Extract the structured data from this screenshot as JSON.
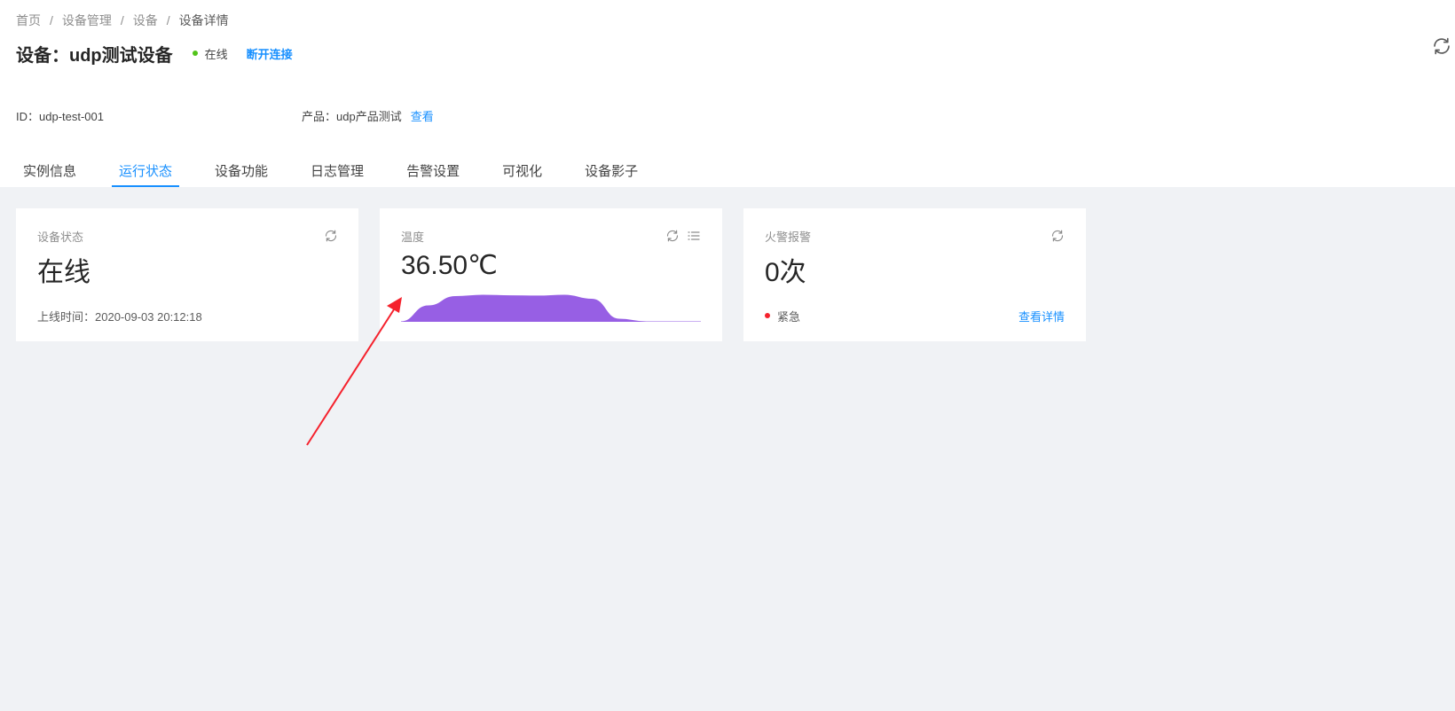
{
  "breadcrumb": [
    "首页",
    "设备管理",
    "设备",
    "设备详情"
  ],
  "breadcrumb_separator": "/",
  "device": {
    "title": "设备：udp测试设备",
    "status_text": "在线",
    "status_color": "#52c41a",
    "disconnect_label": "断开连接"
  },
  "info": {
    "id_text": "ID：udp-test-001",
    "product_text": "产品：udp产品测试",
    "product_link": "查看"
  },
  "tabs": [
    {
      "label": "实例信息",
      "active": false
    },
    {
      "label": "运行状态",
      "active": true
    },
    {
      "label": "设备功能",
      "active": false
    },
    {
      "label": "日志管理",
      "active": false
    },
    {
      "label": "告警设置",
      "active": false
    },
    {
      "label": "可视化",
      "active": false
    },
    {
      "label": "设备影子",
      "active": false
    }
  ],
  "cards": {
    "device_status": {
      "label": "设备状态",
      "value": "在线",
      "footer": "上线时间：2020-09-03 20:12:18",
      "icon": "refresh-icon"
    },
    "temperature": {
      "label": "温度",
      "value": "36.50℃",
      "icons": [
        "refresh-icon",
        "list-icon"
      ],
      "sparkline_color": "#975fe4",
      "sparkline": [
        0,
        0.6,
        0.95,
        1.0,
        0.98,
        0.97,
        1.0,
        0.85,
        0.1,
        0,
        0,
        0
      ]
    },
    "fire_alarm": {
      "label": "火警报警",
      "value": "0次",
      "level": "紧急",
      "level_color": "#f5222d",
      "detail_link": "查看详情",
      "icon": "refresh-icon"
    }
  },
  "colors": {
    "primary": "#1890ff",
    "background": "#f0f2f5",
    "annotation_arrow": "#f5222d"
  }
}
